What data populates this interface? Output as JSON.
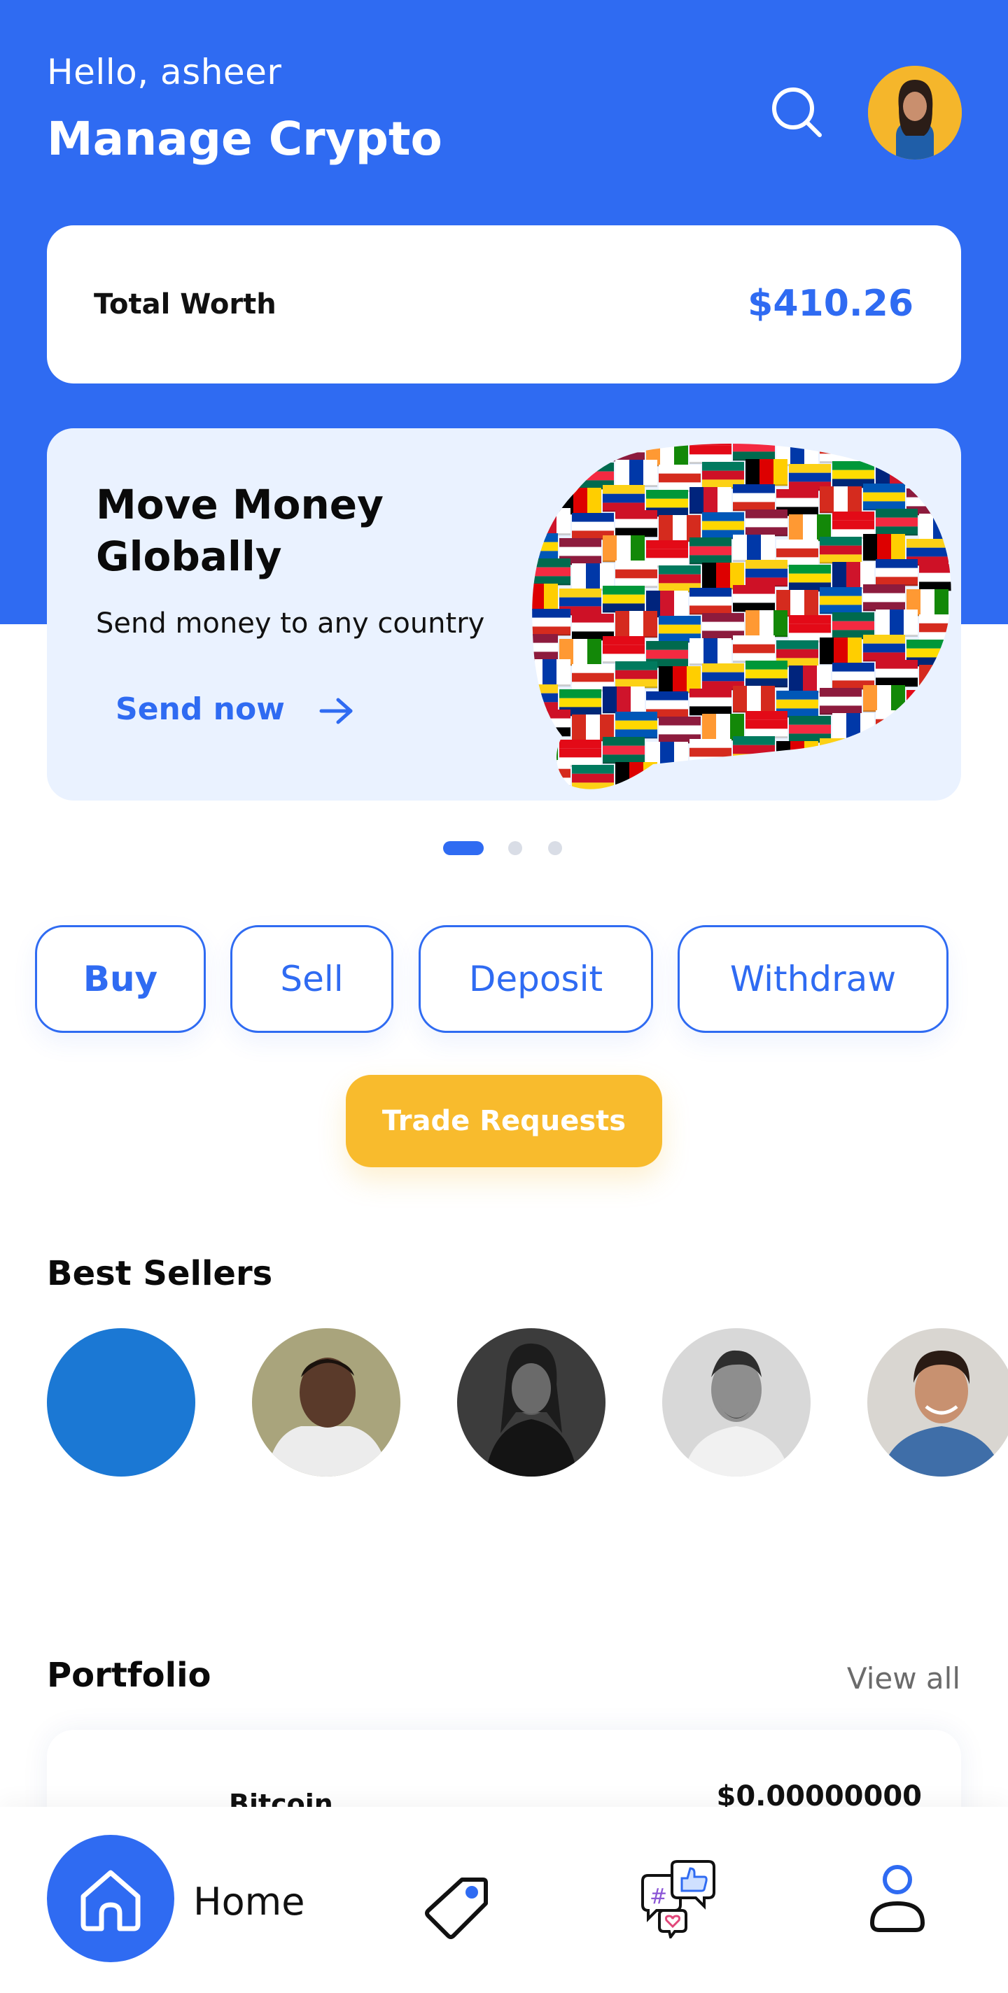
{
  "header": {
    "greeting": "Hello, asheer",
    "title": "Manage Crypto"
  },
  "worth": {
    "label": "Total Worth",
    "value": "$410.26"
  },
  "promo": {
    "title": "Move Money Globally",
    "subtitle": "Send money to any country",
    "cta": "Send now"
  },
  "carousel": {
    "slides": 3,
    "active_index": 0
  },
  "actions": {
    "buy": "Buy",
    "sell": "Sell",
    "deposit": "Deposit",
    "withdraw": "Withdraw",
    "trade_requests": "Trade Requests"
  },
  "best_sellers": {
    "title": "Best Sellers",
    "count": 5
  },
  "portfolio": {
    "title": "Portfolio",
    "view_all": "View all",
    "items": [
      {
        "name": "Bitcoin",
        "value": "$0.00000000"
      }
    ]
  },
  "bottom_nav": {
    "home": "Home",
    "icons": [
      "home-icon",
      "tag-icon",
      "social-chat-icon",
      "user-icon"
    ]
  },
  "colors": {
    "primary": "#2f6bf2",
    "accent_yellow": "#f8bb2d",
    "promo_bg": "#eaf2ff",
    "placeholder_seller": "#1b78d4"
  }
}
